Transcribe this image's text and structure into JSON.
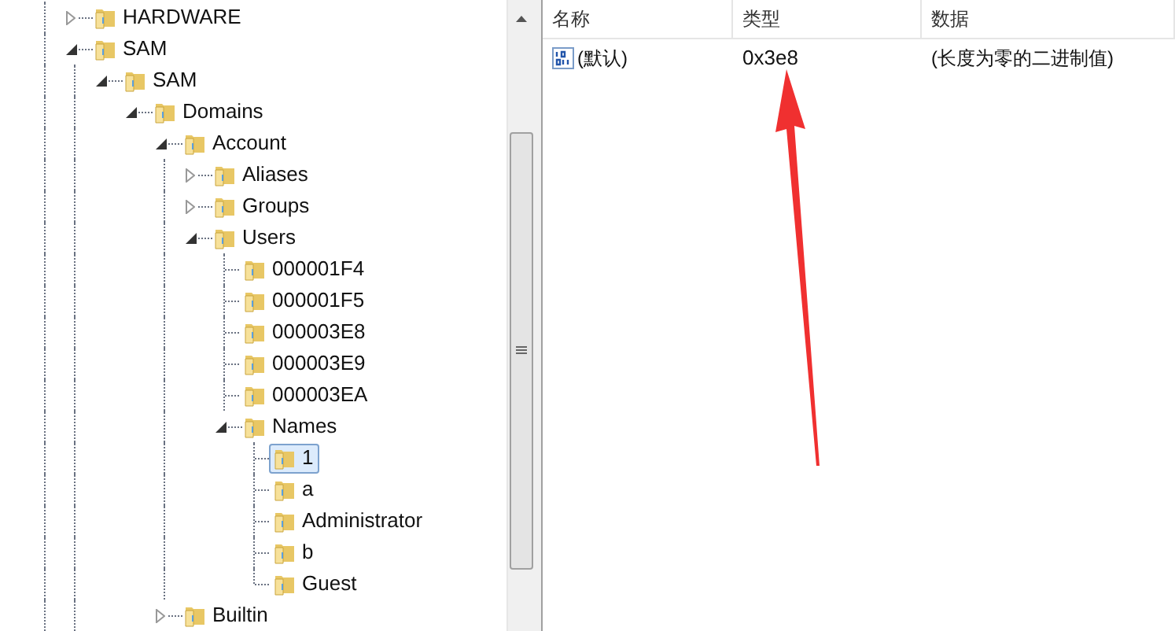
{
  "tree": [
    {
      "label": "HARDWARE",
      "expanded": false,
      "selected": false
    },
    {
      "label": "SAM",
      "expanded": true,
      "selected": false,
      "children": [
        {
          "label": "SAM",
          "expanded": true,
          "selected": false,
          "children": [
            {
              "label": "Domains",
              "expanded": true,
              "selected": false,
              "children": [
                {
                  "label": "Account",
                  "expanded": true,
                  "selected": false,
                  "children": [
                    {
                      "label": "Aliases",
                      "expanded": false,
                      "selected": false
                    },
                    {
                      "label": "Groups",
                      "expanded": false,
                      "selected": false
                    },
                    {
                      "label": "Users",
                      "expanded": true,
                      "selected": false,
                      "children": [
                        {
                          "label": "000001F4",
                          "selected": false
                        },
                        {
                          "label": "000001F5",
                          "selected": false
                        },
                        {
                          "label": "000003E8",
                          "selected": false
                        },
                        {
                          "label": "000003E9",
                          "selected": false
                        },
                        {
                          "label": "000003EA",
                          "selected": false
                        },
                        {
                          "label": "Names",
                          "expanded": true,
                          "selected": false,
                          "children": [
                            {
                              "label": "1",
                              "selected": true
                            },
                            {
                              "label": "a",
                              "selected": false
                            },
                            {
                              "label": "Administrator",
                              "selected": false
                            },
                            {
                              "label": "b",
                              "selected": false
                            },
                            {
                              "label": "Guest",
                              "selected": false
                            }
                          ]
                        }
                      ]
                    }
                  ]
                },
                {
                  "label": "Builtin",
                  "expanded": false,
                  "selected": false
                }
              ]
            }
          ]
        }
      ]
    }
  ],
  "list": {
    "columns": [
      "名称",
      "类型",
      "数据"
    ],
    "rows": [
      {
        "name": "(默认)",
        "type": "0x3e8",
        "data": "(长度为零的二进制值)"
      }
    ]
  }
}
